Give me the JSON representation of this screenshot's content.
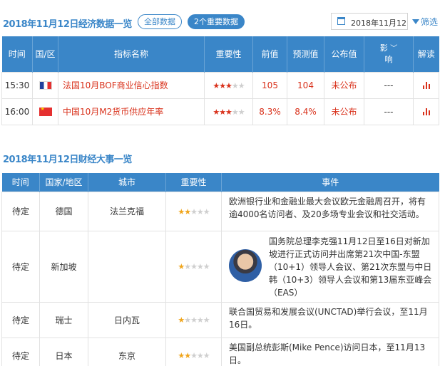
{
  "section1": {
    "title": "2018年11月12日经济数据一览",
    "filter_all": "全部数据",
    "filter_important": "2个重要数据",
    "date_value": "2018年11月12",
    "filter_label": "筛选",
    "columns": [
      "时间",
      "国/区",
      "指标名称",
      "重要性",
      "前值",
      "预测值",
      "公布值",
      "影响",
      "解读"
    ],
    "rows": [
      {
        "time": "15:30",
        "country_flag": "france-flag-icon",
        "name": "法国10月BOF商业信心指数",
        "importance": 3,
        "previous": "105",
        "forecast": "104",
        "actual": "未公布",
        "impact": "---"
      },
      {
        "time": "16:00",
        "country_flag": "china-flag-icon",
        "name": "中国10月M2货币供应年率",
        "importance": 3,
        "previous": "8.3%",
        "forecast": "8.4%",
        "actual": "未公布",
        "impact": "---"
      }
    ]
  },
  "section2": {
    "title": "2018年11月12日财经大事一览",
    "columns": [
      "时间",
      "国家/地区",
      "城市",
      "重要性",
      "事件"
    ],
    "rows": [
      {
        "time": "待定",
        "country": "德国",
        "city": "法兰克福",
        "importance": 2,
        "event": "欧洲银行业和金融业最大会议欧元金融周召开，将有逾4000名访问者、及20多场专业会议和社交活动。",
        "has_photo": false
      },
      {
        "time": "待定",
        "country": "新加坡",
        "city": "",
        "importance": 1,
        "event": "国务院总理李克强11月12日至16日对新加坡进行正式访问并出席第21次中国-东盟（10+1）领导人会议、第21次东盟与中日韩（10+3）领导人会议和第13届东亚峰会（EAS）",
        "has_photo": true
      },
      {
        "time": "待定",
        "country": "瑞士",
        "city": "日内瓦",
        "importance": 1,
        "event": "联合国贸易和发展会议(UNCTAD)举行会议，至11月16日。",
        "has_photo": false
      },
      {
        "time": "待定",
        "country": "日本",
        "city": "东京",
        "importance": 2,
        "event": "美国副总统彭斯(Mike Pence)访问日本，至11月13日。",
        "has_photo": false
      }
    ]
  },
  "colors": {
    "accent": "#3a86c8",
    "highlight": "#d9321c",
    "star_gold": "#f0a51c"
  }
}
